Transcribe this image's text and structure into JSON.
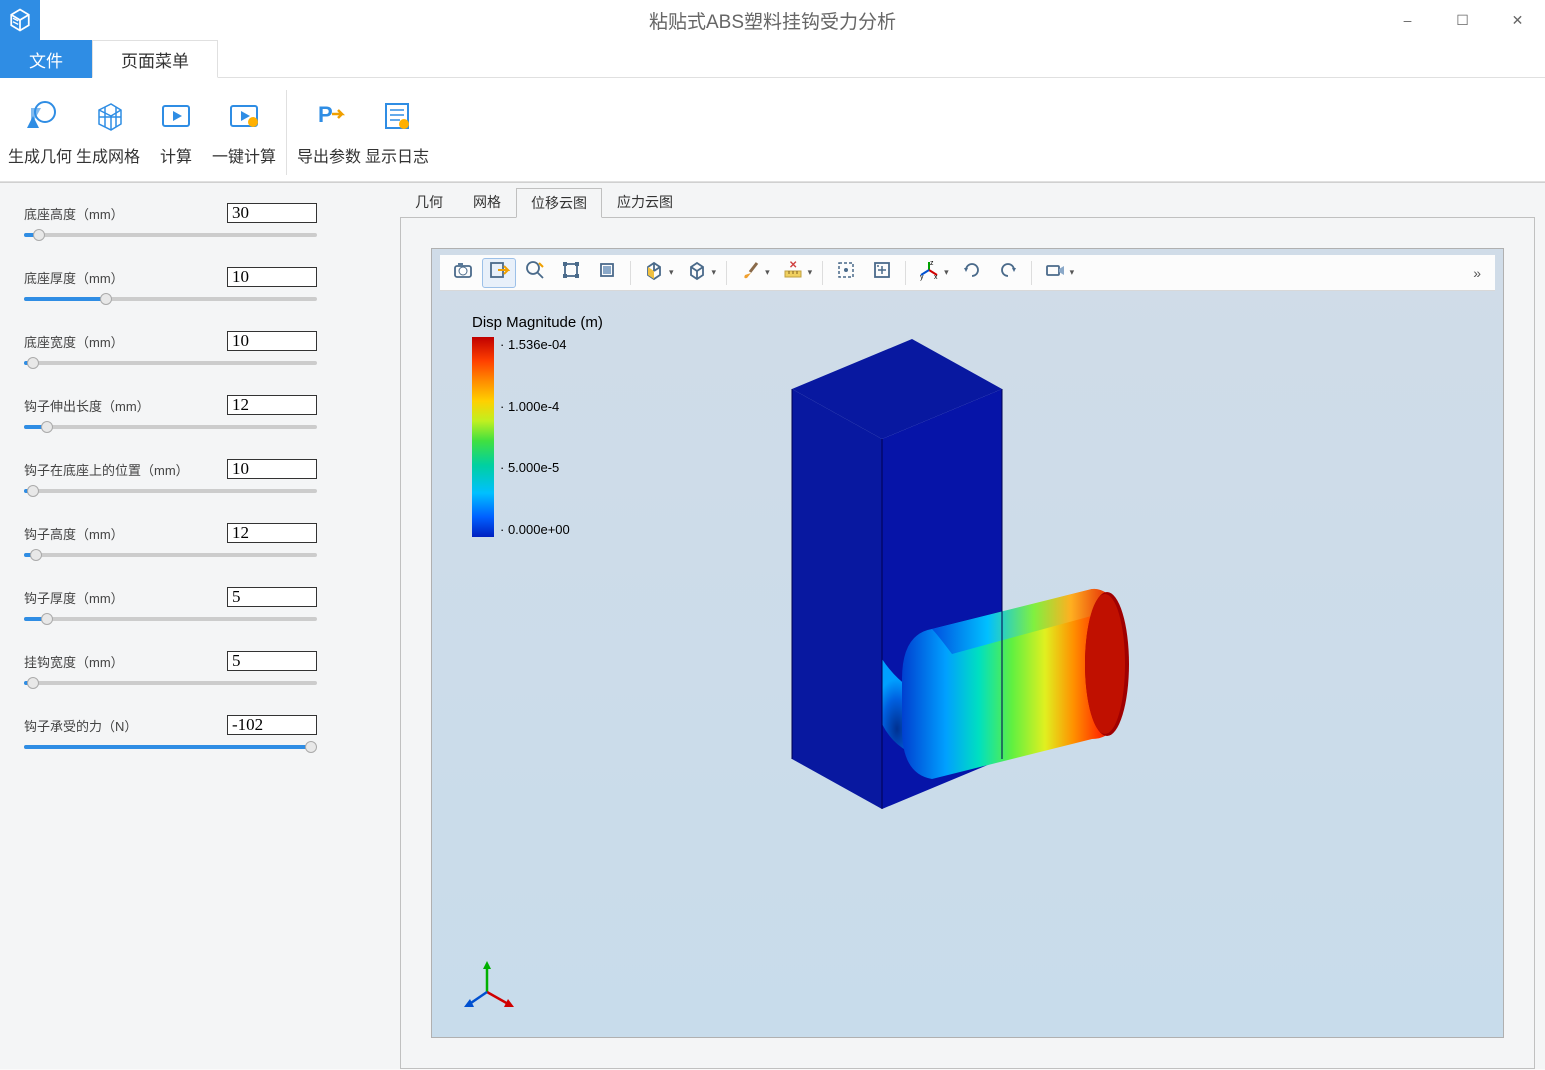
{
  "window": {
    "title": "粘贴式ABS塑料挂钩受力分析",
    "controls": {
      "min": "–",
      "max": "☐",
      "close": "✕"
    }
  },
  "menu_tabs": {
    "file": "文件",
    "page": "页面菜单"
  },
  "ribbon": [
    {
      "icon": "geometry",
      "label": "生成几何"
    },
    {
      "icon": "mesh",
      "label": "生成网格"
    },
    {
      "icon": "compute",
      "label": "计算"
    },
    {
      "icon": "onekey",
      "label": "一键计算"
    },
    {
      "sep": true
    },
    {
      "icon": "export",
      "label": "导出参数"
    },
    {
      "icon": "log",
      "label": "显示日志"
    }
  ],
  "params": [
    {
      "label": "底座高度（mm）",
      "value": "30",
      "pct": 5
    },
    {
      "label": "底座厚度（mm）",
      "value": "10",
      "pct": 28
    },
    {
      "label": "底座宽度（mm）",
      "value": "10",
      "pct": 3
    },
    {
      "label": "钩子伸出长度（mm）",
      "value": "12",
      "pct": 8
    },
    {
      "label": "钩子在底座上的位置（mm）",
      "value": "10",
      "pct": 3
    },
    {
      "label": "钩子高度（mm）",
      "value": "12",
      "pct": 4
    },
    {
      "label": "钩子厚度（mm）",
      "value": "5",
      "pct": 8
    },
    {
      "label": "挂钩宽度（mm）",
      "value": "5",
      "pct": 3
    },
    {
      "label": "钩子承受的力（N）",
      "value": "-102",
      "pct": 98
    }
  ],
  "view_tabs": [
    "几何",
    "网格",
    "位移云图",
    "应力云图"
  ],
  "view_active_index": 2,
  "canvas_toolbar": [
    {
      "icon": "camera"
    },
    {
      "icon": "export-arrow",
      "active": true
    },
    {
      "icon": "zoom-wand"
    },
    {
      "icon": "box-handles"
    },
    {
      "icon": "square"
    },
    {
      "sep": true
    },
    {
      "icon": "cube-front",
      "drop": true
    },
    {
      "icon": "cube-wire",
      "drop": true
    },
    {
      "sep": true
    },
    {
      "icon": "brush",
      "drop": true
    },
    {
      "icon": "ruler-x",
      "drop": true
    },
    {
      "sep": true
    },
    {
      "icon": "select-dashed"
    },
    {
      "icon": "fit-extents"
    },
    {
      "sep": true
    },
    {
      "icon": "axes",
      "drop": true
    },
    {
      "icon": "rotate-cw"
    },
    {
      "icon": "rotate-ccw"
    },
    {
      "sep": true
    },
    {
      "icon": "video-camera",
      "drop": true
    }
  ],
  "legend": {
    "title": "Disp Magnitude (m)",
    "ticks": [
      "1.536e-04",
      "1.000e-4",
      "5.000e-5",
      "0.000e+00"
    ]
  },
  "chart_data": {
    "type": "heatmap",
    "title": "Disp Magnitude (m)",
    "colorscale": "jet",
    "range_min": 0.0,
    "range_max": 0.0001536,
    "ticks": [
      0.0,
      5e-05,
      0.0001,
      0.0001536
    ],
    "unit": "m",
    "description": "FEA displacement magnitude contour on ABS hook; base block near 0, hook tip at max ~1.536e-04 m"
  }
}
